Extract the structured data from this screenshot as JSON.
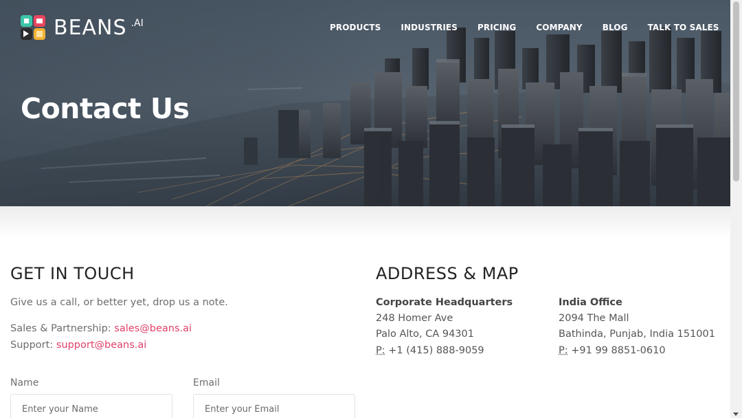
{
  "brand": {
    "name": "BEANS",
    "suffix": ".AI"
  },
  "nav": {
    "items": [
      {
        "label": "PRODUCTS"
      },
      {
        "label": "INDUSTRIES"
      },
      {
        "label": "PRICING"
      },
      {
        "label": "COMPANY"
      },
      {
        "label": "BLOG"
      },
      {
        "label": "TALK TO SALES"
      }
    ]
  },
  "hero": {
    "title": "Contact Us"
  },
  "contact": {
    "title": "GET IN TOUCH",
    "intro": "Give us a call, or better yet, drop us a note.",
    "sales_label": "Sales & Partnership: ",
    "sales_email": "sales@beans.ai",
    "support_label": "Support: ",
    "support_email": "support@beans.ai",
    "form": {
      "name_label": "Name",
      "name_placeholder": "Enter your Name",
      "email_label": "Email",
      "email_placeholder": "Enter your Email"
    }
  },
  "address": {
    "title": "ADDRESS & MAP",
    "offices": [
      {
        "heading": "Corporate Headquarters",
        "line1": "248 Homer Ave",
        "line2": "Palo Alto, CA 94301",
        "phone_prefix": "P:",
        "phone": " +1 (415) 888-9059"
      },
      {
        "heading": "India Office",
        "line1": "2094 The Mall",
        "line2": "Bathinda, Punjab, India 151001",
        "phone_prefix": "P:",
        "phone": " +91 99 8851-0610"
      }
    ]
  },
  "colors": {
    "accent": "#e0406a",
    "heading": "#222222",
    "body_text": "#6d6d6d"
  }
}
